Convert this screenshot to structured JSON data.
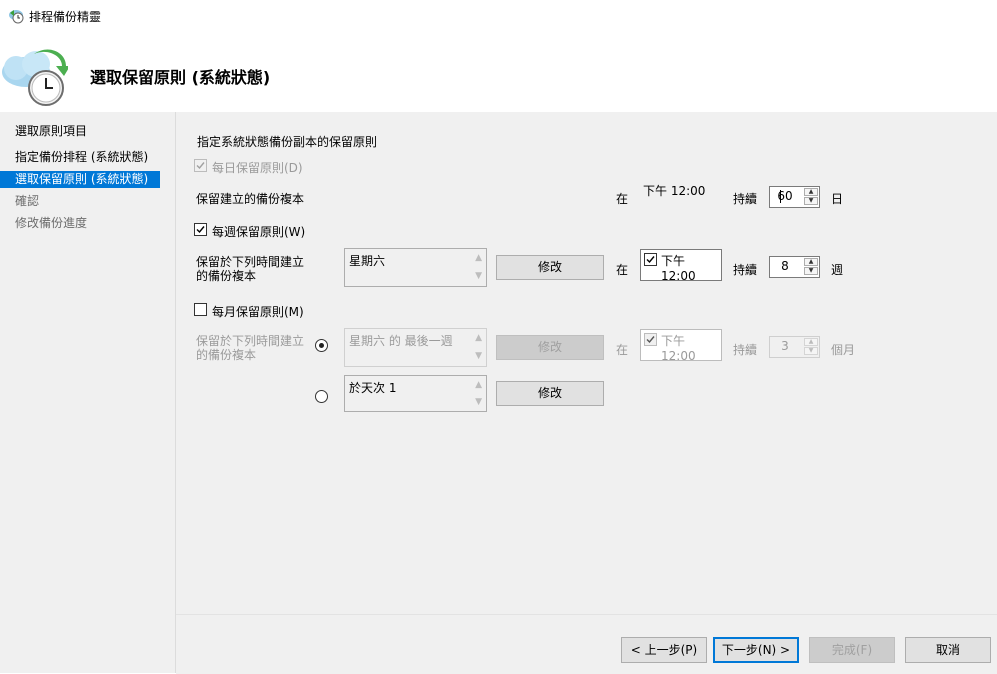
{
  "window": {
    "title": "排程備份精靈",
    "icon": "backup-wizard-icon"
  },
  "header": {
    "title": "選取保留原則 (系統狀態)",
    "icon": "cloud-clock-icon"
  },
  "sidebar": {
    "items": [
      {
        "label": "選取原則項目",
        "state": "normal"
      },
      {
        "label": "指定備份排程 (系統狀態)",
        "state": "normal"
      },
      {
        "label": "選取保留原則 (系統狀態)",
        "state": "active"
      },
      {
        "label": "確認",
        "state": "disabled"
      },
      {
        "label": "修改備份進度",
        "state": "disabled"
      }
    ]
  },
  "content": {
    "intro": "指定系統狀態備份副本的保留原則",
    "daily": {
      "checkbox_label": "每日保留原則(D)",
      "desc": "保留建立的備份複本",
      "at_label": "在",
      "time": "下午 12:00",
      "duration_label": "持續",
      "value": "60",
      "unit": "日"
    },
    "weekly": {
      "checkbox_label": "每週保留原則(W)",
      "desc": "保留於下列時間建立的備份複本",
      "day": "星期六",
      "modify": "修改",
      "at_label": "在",
      "time": "下午 12:00",
      "duration_label": "持續",
      "value": "8",
      "unit": "週"
    },
    "monthly": {
      "checkbox_label": "每月保留原則(M)",
      "desc": "保留於下列時間建立的備份複本",
      "option1": "星期六 的 最後一週",
      "option2": "於天次 1",
      "modify1": "修改",
      "modify2": "修改",
      "at_label": "在",
      "time": "下午 12:00",
      "duration_label": "持續",
      "value": "3",
      "unit": "個月"
    }
  },
  "footer": {
    "back": "< 上一步(P)",
    "next": "下一步(N) >",
    "finish": "完成(F)",
    "cancel": "取消"
  },
  "colors": {
    "accent": "#0078d7",
    "panel": "#f0f0f0"
  }
}
